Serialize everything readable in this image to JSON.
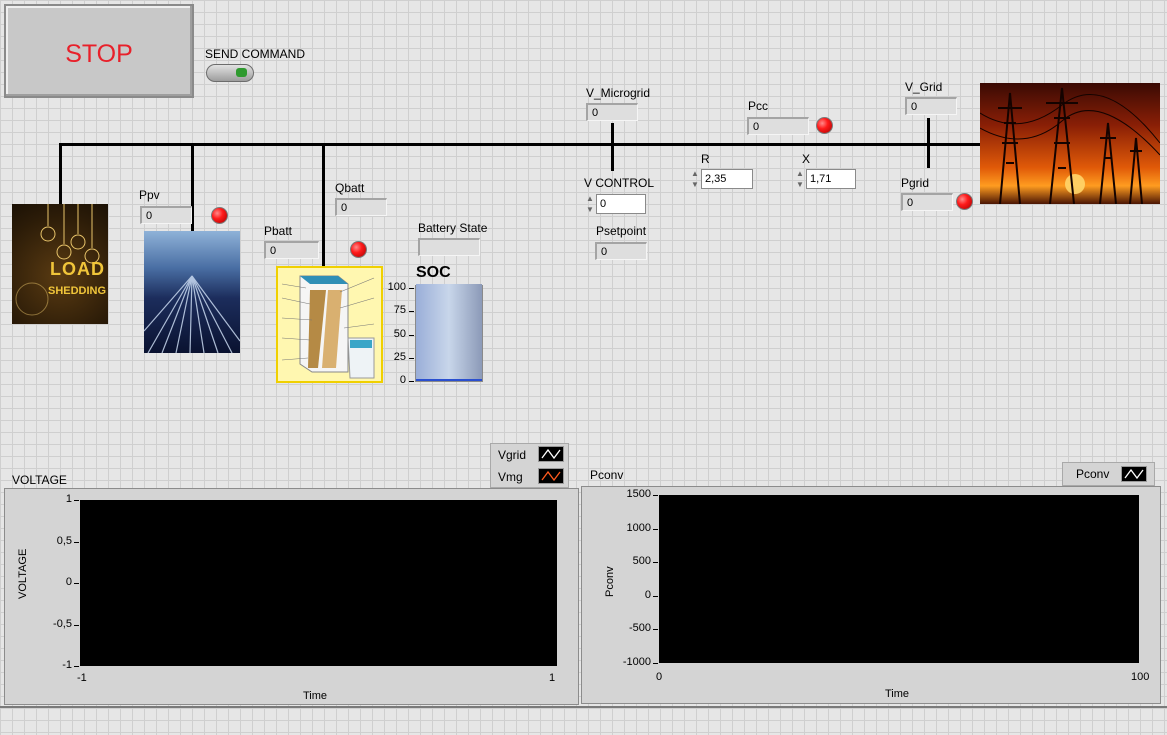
{
  "stop_button": {
    "label": "STOP"
  },
  "send_command": {
    "label": "SEND COMMAND"
  },
  "v_microgrid": {
    "label": "V_Microgrid",
    "value": "0"
  },
  "pcc": {
    "label": "Pcc",
    "value": "0"
  },
  "v_grid": {
    "label": "V_Grid",
    "value": "0"
  },
  "ppv": {
    "label": "Ppv",
    "value": "0"
  },
  "qbatt": {
    "label": "Qbatt",
    "value": "0"
  },
  "pbatt": {
    "label": "Pbatt",
    "value": "0"
  },
  "battery_state": {
    "label": "Battery State",
    "value": ""
  },
  "v_control": {
    "label": "V CONTROL",
    "value": "0"
  },
  "psetpoint": {
    "label": "Psetpoint",
    "value": "0"
  },
  "r": {
    "label": "R",
    "value": "2,35"
  },
  "x": {
    "label": "X",
    "value": "1,71"
  },
  "pgrid": {
    "label": "Pgrid",
    "value": "0"
  },
  "load_shedding": {
    "line1": "LOAD",
    "line2": "SHEDDING"
  },
  "soc": {
    "label": "SOC",
    "ticks": [
      "100",
      "75",
      "50",
      "25",
      "0"
    ],
    "value": 100
  },
  "colors": {
    "led": "#ff1a1a",
    "stop_text": "#e8202a",
    "plot_bg": "#000000"
  },
  "voltage_chart": {
    "title": "VOLTAGE",
    "legend": [
      {
        "name": "Vgrid",
        "color": "#ffffff"
      },
      {
        "name": "Vmg",
        "color": "#ff5a1e"
      }
    ]
  },
  "pconv_chart": {
    "title": "Pconv",
    "legend": [
      {
        "name": "Pconv",
        "color": "#ffffff"
      }
    ]
  },
  "chart_data": [
    {
      "type": "line",
      "title": "VOLTAGE",
      "xlabel": "Time",
      "ylabel": "VOLTAGE",
      "xlim": [
        -1,
        1
      ],
      "ylim": [
        -1,
        1
      ],
      "x_ticks": [
        "-1",
        "1"
      ],
      "y_ticks": [
        "1",
        "0,5",
        "0",
        "-0,5",
        "-1"
      ],
      "series": [
        {
          "name": "Vgrid",
          "values": []
        },
        {
          "name": "Vmg",
          "values": []
        }
      ],
      "legend": "top-right",
      "grid": false
    },
    {
      "type": "line",
      "title": "Pconv",
      "xlabel": "Time",
      "ylabel": "Pconv",
      "xlim": [
        0,
        100
      ],
      "ylim": [
        -1000,
        1500
      ],
      "x_ticks": [
        "0",
        "100"
      ],
      "y_ticks": [
        "1500",
        "1000",
        "500",
        "0",
        "-500",
        "-1000"
      ],
      "series": [
        {
          "name": "Pconv",
          "values": []
        }
      ],
      "legend": "top-right",
      "grid": false
    }
  ]
}
